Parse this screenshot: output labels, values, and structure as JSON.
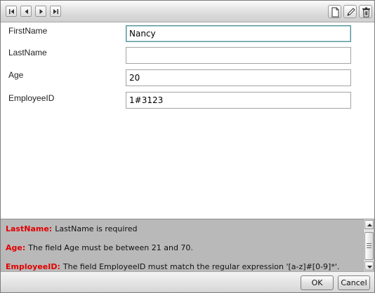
{
  "toolbar": {
    "nav_icons": [
      "first-record-icon",
      "previous-record-icon",
      "next-record-icon",
      "last-record-icon"
    ],
    "action_icons": [
      "new-document-icon",
      "edit-pencil-icon",
      "delete-trash-icon"
    ]
  },
  "form": {
    "fields": [
      {
        "label": "FirstName",
        "value": "Nancy"
      },
      {
        "label": "LastName",
        "value": ""
      },
      {
        "label": "Age",
        "value": "20"
      },
      {
        "label": "EmployeeID",
        "value": "1#3123"
      }
    ]
  },
  "validation_summary": {
    "errors": [
      {
        "field": "LastName:",
        "message": "LastName is required"
      },
      {
        "field": "Age:",
        "message": "The field Age must be between 21 and 70."
      },
      {
        "field": "EmployeeID:",
        "message": "The field EmployeeID must match the regular expression '[a-z]#[0-9]*'."
      }
    ],
    "error_color": "#e00000"
  },
  "footer": {
    "ok_label": "OK",
    "cancel_label": "Cancel"
  }
}
